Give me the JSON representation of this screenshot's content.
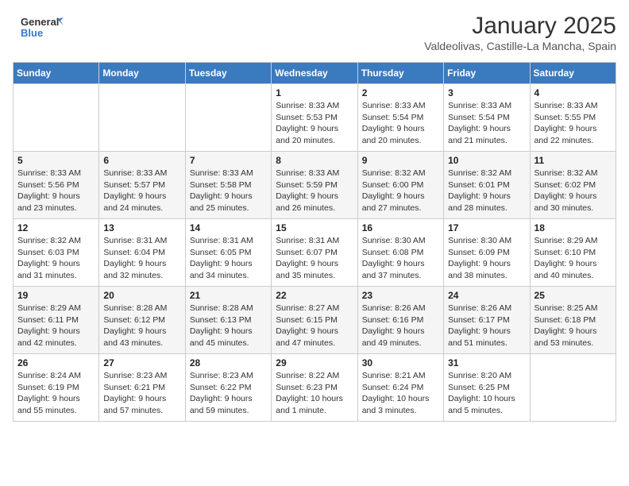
{
  "header": {
    "logo_line1": "General",
    "logo_line2": "Blue",
    "month": "January 2025",
    "location": "Valdeolivas, Castille-La Mancha, Spain"
  },
  "weekdays": [
    "Sunday",
    "Monday",
    "Tuesday",
    "Wednesday",
    "Thursday",
    "Friday",
    "Saturday"
  ],
  "weeks": [
    [
      {
        "day": "",
        "sunrise": "",
        "sunset": "",
        "daylight": ""
      },
      {
        "day": "",
        "sunrise": "",
        "sunset": "",
        "daylight": ""
      },
      {
        "day": "",
        "sunrise": "",
        "sunset": "",
        "daylight": ""
      },
      {
        "day": "1",
        "sunrise": "Sunrise: 8:33 AM",
        "sunset": "Sunset: 5:53 PM",
        "daylight": "Daylight: 9 hours and 20 minutes."
      },
      {
        "day": "2",
        "sunrise": "Sunrise: 8:33 AM",
        "sunset": "Sunset: 5:54 PM",
        "daylight": "Daylight: 9 hours and 20 minutes."
      },
      {
        "day": "3",
        "sunrise": "Sunrise: 8:33 AM",
        "sunset": "Sunset: 5:54 PM",
        "daylight": "Daylight: 9 hours and 21 minutes."
      },
      {
        "day": "4",
        "sunrise": "Sunrise: 8:33 AM",
        "sunset": "Sunset: 5:55 PM",
        "daylight": "Daylight: 9 hours and 22 minutes."
      }
    ],
    [
      {
        "day": "5",
        "sunrise": "Sunrise: 8:33 AM",
        "sunset": "Sunset: 5:56 PM",
        "daylight": "Daylight: 9 hours and 23 minutes."
      },
      {
        "day": "6",
        "sunrise": "Sunrise: 8:33 AM",
        "sunset": "Sunset: 5:57 PM",
        "daylight": "Daylight: 9 hours and 24 minutes."
      },
      {
        "day": "7",
        "sunrise": "Sunrise: 8:33 AM",
        "sunset": "Sunset: 5:58 PM",
        "daylight": "Daylight: 9 hours and 25 minutes."
      },
      {
        "day": "8",
        "sunrise": "Sunrise: 8:33 AM",
        "sunset": "Sunset: 5:59 PM",
        "daylight": "Daylight: 9 hours and 26 minutes."
      },
      {
        "day": "9",
        "sunrise": "Sunrise: 8:32 AM",
        "sunset": "Sunset: 6:00 PM",
        "daylight": "Daylight: 9 hours and 27 minutes."
      },
      {
        "day": "10",
        "sunrise": "Sunrise: 8:32 AM",
        "sunset": "Sunset: 6:01 PM",
        "daylight": "Daylight: 9 hours and 28 minutes."
      },
      {
        "day": "11",
        "sunrise": "Sunrise: 8:32 AM",
        "sunset": "Sunset: 6:02 PM",
        "daylight": "Daylight: 9 hours and 30 minutes."
      }
    ],
    [
      {
        "day": "12",
        "sunrise": "Sunrise: 8:32 AM",
        "sunset": "Sunset: 6:03 PM",
        "daylight": "Daylight: 9 hours and 31 minutes."
      },
      {
        "day": "13",
        "sunrise": "Sunrise: 8:31 AM",
        "sunset": "Sunset: 6:04 PM",
        "daylight": "Daylight: 9 hours and 32 minutes."
      },
      {
        "day": "14",
        "sunrise": "Sunrise: 8:31 AM",
        "sunset": "Sunset: 6:05 PM",
        "daylight": "Daylight: 9 hours and 34 minutes."
      },
      {
        "day": "15",
        "sunrise": "Sunrise: 8:31 AM",
        "sunset": "Sunset: 6:07 PM",
        "daylight": "Daylight: 9 hours and 35 minutes."
      },
      {
        "day": "16",
        "sunrise": "Sunrise: 8:30 AM",
        "sunset": "Sunset: 6:08 PM",
        "daylight": "Daylight: 9 hours and 37 minutes."
      },
      {
        "day": "17",
        "sunrise": "Sunrise: 8:30 AM",
        "sunset": "Sunset: 6:09 PM",
        "daylight": "Daylight: 9 hours and 38 minutes."
      },
      {
        "day": "18",
        "sunrise": "Sunrise: 8:29 AM",
        "sunset": "Sunset: 6:10 PM",
        "daylight": "Daylight: 9 hours and 40 minutes."
      }
    ],
    [
      {
        "day": "19",
        "sunrise": "Sunrise: 8:29 AM",
        "sunset": "Sunset: 6:11 PM",
        "daylight": "Daylight: 9 hours and 42 minutes."
      },
      {
        "day": "20",
        "sunrise": "Sunrise: 8:28 AM",
        "sunset": "Sunset: 6:12 PM",
        "daylight": "Daylight: 9 hours and 43 minutes."
      },
      {
        "day": "21",
        "sunrise": "Sunrise: 8:28 AM",
        "sunset": "Sunset: 6:13 PM",
        "daylight": "Daylight: 9 hours and 45 minutes."
      },
      {
        "day": "22",
        "sunrise": "Sunrise: 8:27 AM",
        "sunset": "Sunset: 6:15 PM",
        "daylight": "Daylight: 9 hours and 47 minutes."
      },
      {
        "day": "23",
        "sunrise": "Sunrise: 8:26 AM",
        "sunset": "Sunset: 6:16 PM",
        "daylight": "Daylight: 9 hours and 49 minutes."
      },
      {
        "day": "24",
        "sunrise": "Sunrise: 8:26 AM",
        "sunset": "Sunset: 6:17 PM",
        "daylight": "Daylight: 9 hours and 51 minutes."
      },
      {
        "day": "25",
        "sunrise": "Sunrise: 8:25 AM",
        "sunset": "Sunset: 6:18 PM",
        "daylight": "Daylight: 9 hours and 53 minutes."
      }
    ],
    [
      {
        "day": "26",
        "sunrise": "Sunrise: 8:24 AM",
        "sunset": "Sunset: 6:19 PM",
        "daylight": "Daylight: 9 hours and 55 minutes."
      },
      {
        "day": "27",
        "sunrise": "Sunrise: 8:23 AM",
        "sunset": "Sunset: 6:21 PM",
        "daylight": "Daylight: 9 hours and 57 minutes."
      },
      {
        "day": "28",
        "sunrise": "Sunrise: 8:23 AM",
        "sunset": "Sunset: 6:22 PM",
        "daylight": "Daylight: 9 hours and 59 minutes."
      },
      {
        "day": "29",
        "sunrise": "Sunrise: 8:22 AM",
        "sunset": "Sunset: 6:23 PM",
        "daylight": "Daylight: 10 hours and 1 minute."
      },
      {
        "day": "30",
        "sunrise": "Sunrise: 8:21 AM",
        "sunset": "Sunset: 6:24 PM",
        "daylight": "Daylight: 10 hours and 3 minutes."
      },
      {
        "day": "31",
        "sunrise": "Sunrise: 8:20 AM",
        "sunset": "Sunset: 6:25 PM",
        "daylight": "Daylight: 10 hours and 5 minutes."
      },
      {
        "day": "",
        "sunrise": "",
        "sunset": "",
        "daylight": ""
      }
    ]
  ]
}
